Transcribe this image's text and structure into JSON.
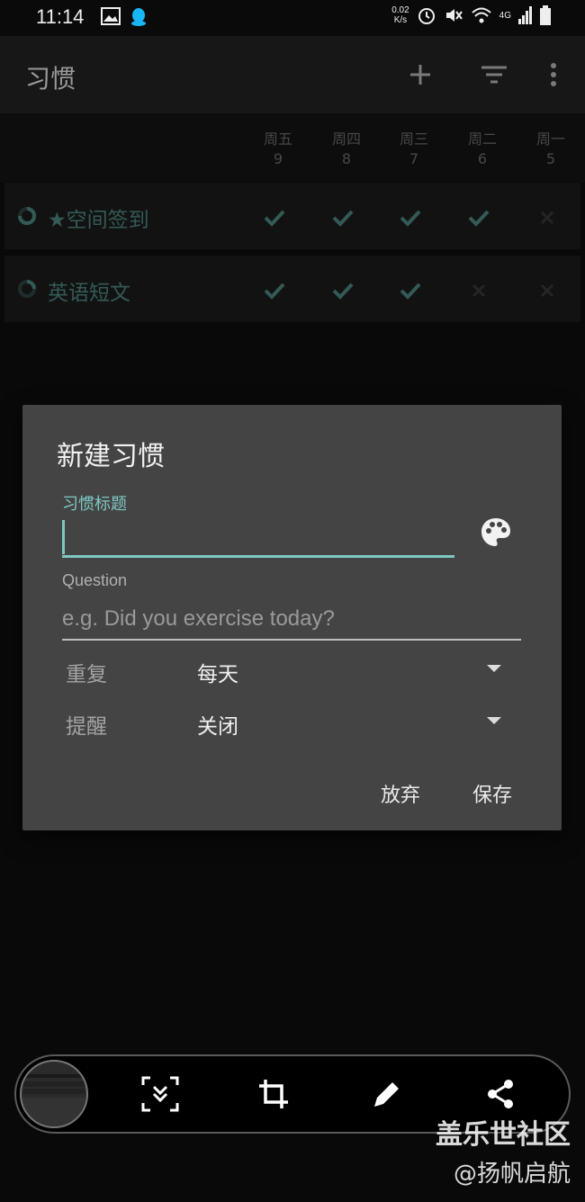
{
  "status_bar": {
    "time": "11:14",
    "net_speed_value": "0.02",
    "net_speed_unit": "K/s",
    "network": "4G",
    "left_icons": [
      "image-icon",
      "qq-icon"
    ],
    "right_icons": [
      "alarm-icon",
      "mute-icon",
      "wifi-icon",
      "signal-icon",
      "battery-icon"
    ]
  },
  "app_bar": {
    "title": "习惯",
    "actions": [
      "add-icon",
      "filter-icon",
      "more-vert-icon"
    ]
  },
  "days": [
    {
      "name": "周五",
      "date": "9"
    },
    {
      "name": "周四",
      "date": "8"
    },
    {
      "name": "周三",
      "date": "7"
    },
    {
      "name": "周二",
      "date": "6"
    },
    {
      "name": "周一",
      "date": "5"
    }
  ],
  "habits": [
    {
      "name": "★空间签到",
      "marks": [
        "check",
        "check",
        "check",
        "check",
        "cross"
      ]
    },
    {
      "name": "英语短文",
      "marks": [
        "check",
        "check",
        "check",
        "cross",
        "cross"
      ]
    }
  ],
  "dialog": {
    "title": "新建习惯",
    "habit_title_label": "习惯标题",
    "habit_title_value": "",
    "question_label": "Question",
    "question_placeholder": "e.g. Did you exercise today?",
    "repeat_label": "重复",
    "repeat_value": "每天",
    "reminder_label": "提醒",
    "reminder_value": "关闭",
    "discard_label": "放弃",
    "save_label": "保存"
  },
  "toolbar": {
    "icons": [
      "scroll-capture-icon",
      "crop-icon",
      "pen-icon",
      "share-icon"
    ]
  },
  "watermark": {
    "line1": "盖乐世社区",
    "line2": "@扬帆启航"
  },
  "colors": {
    "accent": "#7ec8c2",
    "check": "#4f8a84",
    "cross": "#3a3a3a",
    "dialog_bg": "#444444"
  }
}
